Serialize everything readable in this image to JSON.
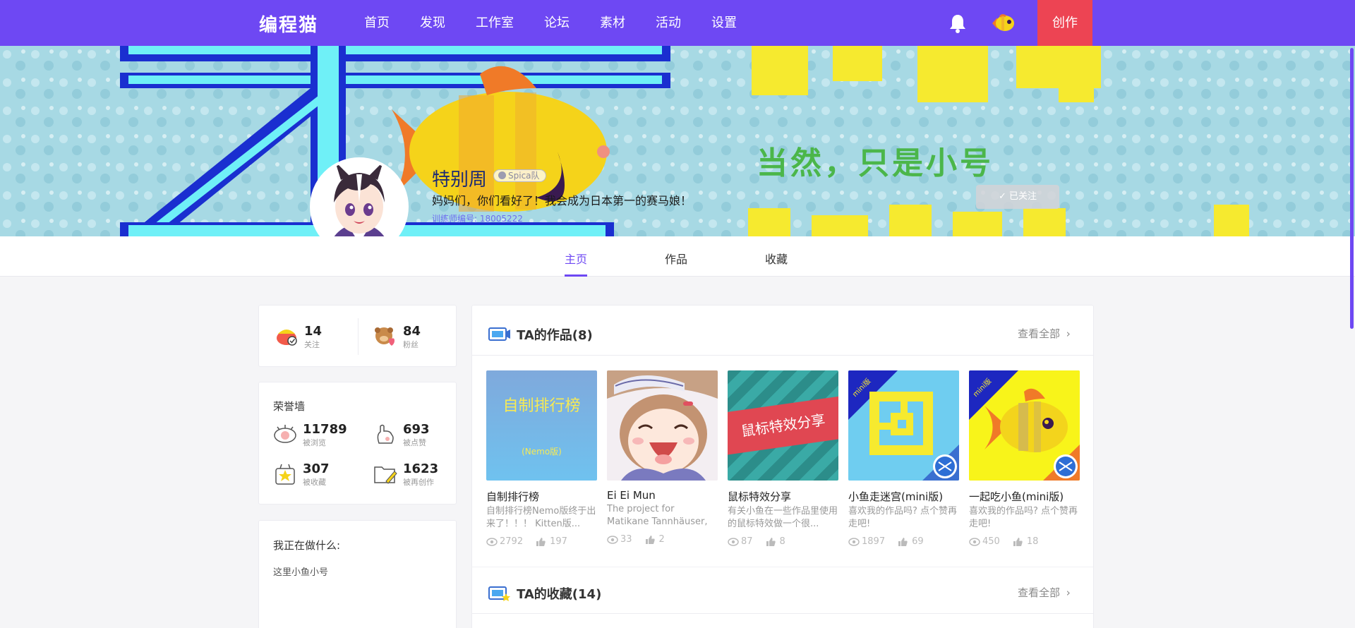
{
  "app": {
    "logo": "编程猫",
    "create": "创作"
  },
  "nav": {
    "items": [
      "首页",
      "发现",
      "工作室",
      "论坛",
      "素材",
      "活动",
      "设置"
    ]
  },
  "profile": {
    "name": "特别周",
    "team_badge": "Spica队",
    "motto": "妈妈们，你们看好了！我会成为日本第一的赛马娘！",
    "trainer_id": "训练师编号: 18005222",
    "follow_state": "✓ 已关注"
  },
  "banner": {
    "text": "当然，只是小号"
  },
  "tabs": [
    "主页",
    "作品",
    "收藏"
  ],
  "social": {
    "following": "14",
    "following_label": "关注",
    "fans": "84",
    "fans_label": "粉丝"
  },
  "honor": {
    "title": "荣誉墙",
    "items": [
      {
        "value": "11789",
        "label": "被浏览"
      },
      {
        "value": "693",
        "label": "被点赞"
      },
      {
        "value": "307",
        "label": "被收藏"
      },
      {
        "value": "1623",
        "label": "被再创作"
      }
    ]
  },
  "doing": {
    "title": "我正在做什么:",
    "text": "这里小鱼小号"
  },
  "works": {
    "title": "TA的作品(8)",
    "view_all": "查看全部",
    "items": [
      {
        "title": "自制排行榜",
        "desc": "自制排行榜Nemo版终于出来了！！！ Kitten版...",
        "views": "2792",
        "likes": "197",
        "thumb_text": "自制排行榜",
        "thumb_sub": "(Nemo版)"
      },
      {
        "title": "Ei Ei Mun",
        "desc": "The project for Matikane Tannhäuser, the cutest...",
        "views": "33",
        "likes": "2"
      },
      {
        "title": "鼠标特效分享",
        "desc": "有关小鱼在一些作品里使用的鼠标特效做一个很...",
        "views": "87",
        "likes": "8",
        "thumb_text": "鼠标特效分享"
      },
      {
        "title": "小鱼走迷宫(mini版)",
        "desc": "喜欢我的作品吗? 点个赞再走吧!",
        "views": "1897",
        "likes": "69",
        "thumb_text": "mini版"
      },
      {
        "title": "一起吃小鱼(mini版)",
        "desc": "喜欢我的作品吗? 点个赞再走吧!",
        "views": "450",
        "likes": "18",
        "thumb_text": "mini版"
      }
    ]
  },
  "favorites": {
    "title": "TA的收藏(14)",
    "view_all": "查看全部"
  }
}
